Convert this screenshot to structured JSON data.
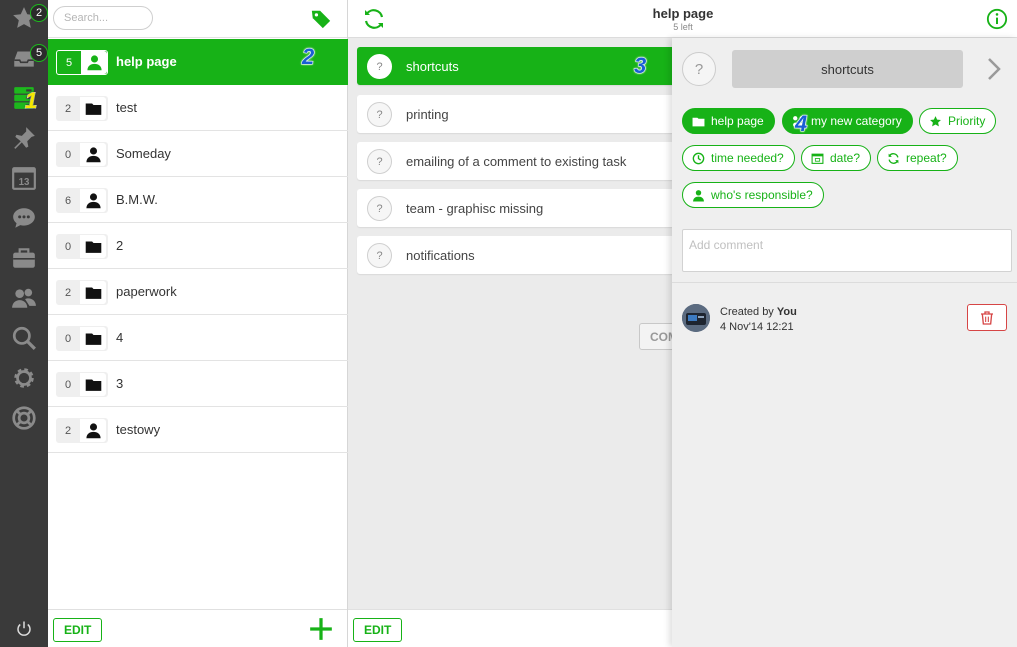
{
  "rail": {
    "items": [
      {
        "icon": "star-icon",
        "badge": "2"
      },
      {
        "icon": "inbox-icon",
        "badge": "5"
      },
      {
        "icon": "projects-icon",
        "callout": "1"
      },
      {
        "icon": "pin-icon"
      },
      {
        "icon": "calendar-icon",
        "day": "13"
      },
      {
        "icon": "chat-icon"
      },
      {
        "icon": "briefcase-icon"
      },
      {
        "icon": "users-icon"
      },
      {
        "icon": "search-icon"
      },
      {
        "icon": "gear-icon"
      },
      {
        "icon": "help-lifebuoy-icon"
      }
    ],
    "power_icon": "power-icon"
  },
  "projects": {
    "search_placeholder": "Search...",
    "callout": "2",
    "items": [
      {
        "count": "5",
        "type": "person",
        "name": "help page",
        "active": true
      },
      {
        "count": "2",
        "type": "folder",
        "name": "test"
      },
      {
        "count": "0",
        "type": "person",
        "name": "Someday"
      },
      {
        "count": "6",
        "type": "person",
        "name": "B.M.W."
      },
      {
        "count": "0",
        "type": "folder",
        "name": "2"
      },
      {
        "count": "2",
        "type": "folder",
        "name": "paperwork"
      },
      {
        "count": "0",
        "type": "folder",
        "name": "4"
      },
      {
        "count": "0",
        "type": "folder",
        "name": "3"
      },
      {
        "count": "2",
        "type": "person",
        "name": "testowy"
      }
    ],
    "edit_label": "EDIT"
  },
  "header": {
    "title": "help page",
    "subtitle": "5 left"
  },
  "tasks": {
    "callout": "3",
    "items": [
      {
        "name": "shortcuts",
        "active": true
      },
      {
        "name": "printing"
      },
      {
        "name": "emailing of a comment to existing task"
      },
      {
        "name": "team - graphisc missing"
      },
      {
        "name": "notifications"
      }
    ],
    "complete_label": "COM",
    "edit_label": "EDIT"
  },
  "detail": {
    "title": "shortcuts",
    "callout": "4",
    "chips": {
      "project": "help page",
      "category": "my new category",
      "priority": "Priority",
      "time": "time needed?",
      "date": "date?",
      "repeat": "repeat?",
      "responsible": "who's responsible?"
    },
    "comment_placeholder": "Add comment",
    "created_prefix": "Created by",
    "created_by": "You",
    "created_date": "4 Nov'14 12:21"
  },
  "colors": {
    "accent": "#17b217",
    "rail": "#3a3a3a",
    "delete": "#d64545"
  }
}
